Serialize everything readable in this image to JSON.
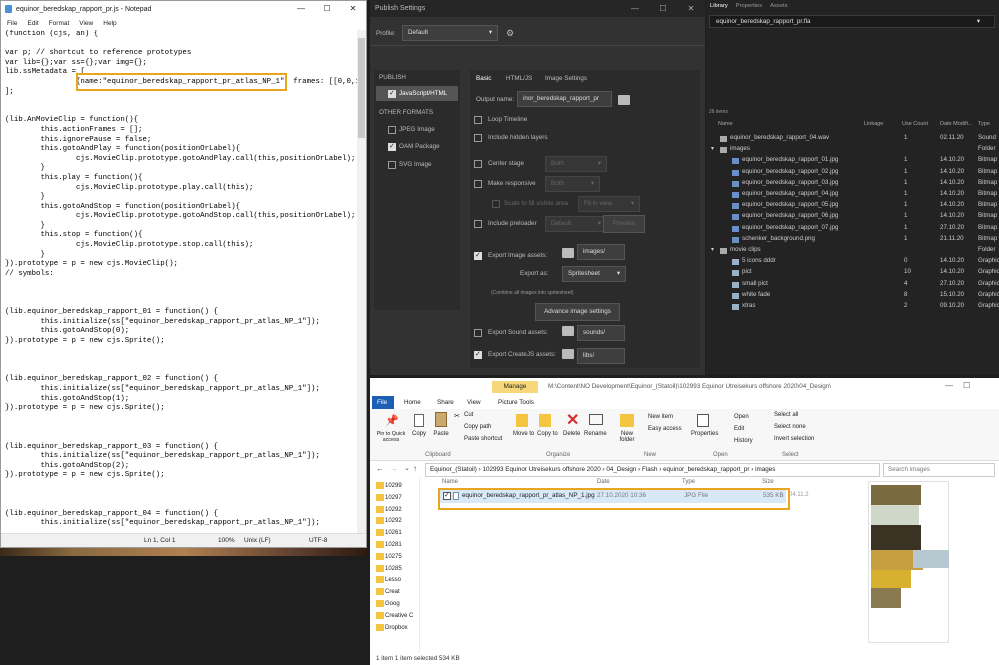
{
  "notepad": {
    "title": "equinor_beredskap_rapport_pr.js - Notepad",
    "menu": [
      "File",
      "Edit",
      "Format",
      "View",
      "Help"
    ],
    "code": "(function (cjs, an) {\n\nvar p; // shortcut to reference prototypes\nvar lib={};var ss={};var img={};\nlib.ssMetadata = [\n\t\t{name:\"equinor_beredskap_rapport_pr_atlas_NP_1\", frames: [[0,0,1344\n];\n\n\n(lib.AnMovieClip = function(){\n\tthis.actionFrames = [];\n\tthis.ignorePause = false;\n\tthis.gotoAndPlay = function(positionOrLabel){\n\t\tcjs.MovieClip.prototype.gotoAndPlay.call(this,positionOrLabel);\n\t}\n\tthis.play = function(){\n\t\tcjs.MovieClip.prototype.play.call(this);\n\t}\n\tthis.gotoAndStop = function(positionOrLabel){\n\t\tcjs.MovieClip.prototype.gotoAndStop.call(this,positionOrLabel);\n\t}\n\tthis.stop = function(){\n\t\tcjs.MovieClip.prototype.stop.call(this);\n\t}\n}).prototype = p = new cjs.MovieClip();\n// symbols:\n\n\n\n(lib.equinor_beredskap_rapport_01 = function() {\n\tthis.initialize(ss[\"equinor_beredskap_rapport_pr_atlas_NP_1\"]);\n\tthis.gotoAndStop(0);\n}).prototype = p = new cjs.Sprite();\n\n\n\n(lib.equinor_beredskap_rapport_02 = function() {\n\tthis.initialize(ss[\"equinor_beredskap_rapport_pr_atlas_NP_1\"]);\n\tthis.gotoAndStop(1);\n}).prototype = p = new cjs.Sprite();\n\n\n\n(lib.equinor_beredskap_rapport_03 = function() {\n\tthis.initialize(ss[\"equinor_beredskap_rapport_pr_atlas_NP_1\"]);\n\tthis.gotoAndStop(2);\n}).prototype = p = new cjs.Sprite();\n\n\n\n(lib.equinor_beredskap_rapport_04 = function() {\n\tthis.initialize(ss[\"equinor_beredskap_rapport_pr_atlas_NP_1\"]);",
    "status": {
      "position": "Ln 1, Col 1",
      "zoom": "100%",
      "eol": "Unix (LF)",
      "encoding": "UTF-8"
    }
  },
  "publish": {
    "title": "Publish Settings",
    "profile_label": "Profile:",
    "profile_value": "Default",
    "publish_header": "PUBLISH",
    "javascript": "JavaScript/HTML",
    "other_formats": "OTHER FORMATS",
    "formats": [
      "JPEG Image",
      "OAM Package",
      "SVG Image"
    ],
    "tabs": [
      "Basic",
      "HTML/JS",
      "Image Settings"
    ],
    "output_label": "Output name:",
    "output_value": "inor_beredskap_rapport_pr",
    "loop": "Loop Timeline",
    "hidden": "Include hidden layers",
    "center": "Center stage",
    "center_val": "Both",
    "responsive": "Make responsive",
    "responsive_val": "Both",
    "scale": "Scale to fill visible area",
    "scale_val": "Fit in view",
    "preloader": "Include preloader",
    "preloader_val": "Default",
    "preview": "Preview",
    "export_images": "Export Image assets:",
    "images_folder": "images/",
    "export_as_label": "Export as:",
    "export_as_val": "Spritesheet",
    "combine_note": "(Combine all images into spritesheet)",
    "advanced": "Advance image settings",
    "export_sound": "Export Sound assets:",
    "sounds_folder": "sounds/",
    "export_createjs": "Export CreateJS assets:",
    "libs_folder": "libs/"
  },
  "library": {
    "tabs": [
      "Library",
      "Properties",
      "Assets"
    ],
    "file": "equinor_beredskap_rapport_pr.fla",
    "count": "26 items",
    "headers": [
      "Name",
      "Linkage",
      "Use Count",
      "Date Modifi...",
      "Type"
    ],
    "rows": [
      {
        "indent": 0,
        "name": "equinor_beredskap_rapport_04.wav",
        "use": "1",
        "date": "02.11.20",
        "type": "Sound",
        "kind": "sound"
      },
      {
        "indent": 0,
        "name": "images",
        "use": "",
        "date": "",
        "type": "Folder",
        "kind": "folder"
      },
      {
        "indent": 1,
        "name": "equinor_beredskap_rapport_01.jpg",
        "use": "1",
        "date": "14.10.20",
        "type": "Bitmap",
        "kind": "bitmap"
      },
      {
        "indent": 1,
        "name": "equinor_beredskap_rapport_02.jpg",
        "use": "1",
        "date": "14.10.20",
        "type": "Bitmap",
        "kind": "bitmap"
      },
      {
        "indent": 1,
        "name": "equinor_beredskap_rapport_03.jpg",
        "use": "1",
        "date": "14.10.20",
        "type": "Bitmap",
        "kind": "bitmap"
      },
      {
        "indent": 1,
        "name": "equinor_beredskap_rapport_04.jpg",
        "use": "1",
        "date": "14.10.20",
        "type": "Bitmap",
        "kind": "bitmap"
      },
      {
        "indent": 1,
        "name": "equinor_beredskap_rapport_05.jpg",
        "use": "1",
        "date": "14.10.20",
        "type": "Bitmap",
        "kind": "bitmap"
      },
      {
        "indent": 1,
        "name": "equinor_beredskap_rapport_06.jpg",
        "use": "1",
        "date": "14.10.20",
        "type": "Bitmap",
        "kind": "bitmap"
      },
      {
        "indent": 1,
        "name": "equinor_beredskap_rapport_07.jpg",
        "use": "1",
        "date": "27.10.20",
        "type": "Bitmap",
        "kind": "bitmap"
      },
      {
        "indent": 1,
        "name": "schenker_background.png",
        "use": "1",
        "date": "21.11.20",
        "type": "Bitmap",
        "kind": "bitmap"
      },
      {
        "indent": 0,
        "name": "movie clips",
        "use": "",
        "date": "",
        "type": "Folder",
        "kind": "folder"
      },
      {
        "indent": 1,
        "name": "5 icons dddr",
        "use": "0",
        "date": "14.10.20",
        "type": "Graphic",
        "kind": "graphic"
      },
      {
        "indent": 1,
        "name": "pict",
        "use": "10",
        "date": "14.10.20",
        "type": "Graphic",
        "kind": "graphic"
      },
      {
        "indent": 1,
        "name": "small pict",
        "use": "4",
        "date": "27.10.20",
        "type": "Graphic",
        "kind": "graphic"
      },
      {
        "indent": 1,
        "name": "white fade",
        "use": "8",
        "date": "15.10.20",
        "type": "Graphic",
        "kind": "graphic"
      },
      {
        "indent": 1,
        "name": "xtras",
        "use": "2",
        "date": "09.10.20",
        "type": "Graphic",
        "kind": "graphic"
      }
    ]
  },
  "explorer": {
    "title": "M:\\Content\\NO Development\\Equinor_(Statoil)\\102993 Equinor Utreisekurs offshore 2020\\04_Design\\",
    "manage": "Manage",
    "tabs": [
      "File",
      "Home",
      "Share",
      "View",
      "Picture Tools"
    ],
    "ribbon": {
      "pin": "Pin to Quick access",
      "copy": "Copy",
      "paste": "Paste",
      "cut": "Cut",
      "copy_path": "Copy path",
      "paste_shortcut": "Paste shortcut",
      "move": "Move to",
      "copy_to": "Copy to",
      "delete": "Delete",
      "rename": "Rename",
      "new_folder": "New folder",
      "new_item": "New item",
      "easy_access": "Easy access",
      "properties": "Properties",
      "open": "Open",
      "edit": "Edit",
      "history": "History",
      "select_all": "Select all",
      "select_none": "Select none",
      "invert": "Invert selection",
      "groups": [
        "Clipboard",
        "Organize",
        "New",
        "Open",
        "Select"
      ]
    },
    "breadcrumb": [
      "Equinor_(Statoil)",
      "102993 Equinor Utreisekurs offshore 2020",
      "04_Design",
      "Flash",
      "equinor_beredskap_rapport_pr",
      "images"
    ],
    "search_placeholder": "Search images",
    "nav": [
      "10299",
      "10297",
      "10292",
      "10292",
      "10261",
      "10281",
      "10275",
      "10285",
      "Lesso",
      "Creat",
      "Goog",
      "Creative C",
      "Dropbox"
    ],
    "columns": [
      "Name",
      "Date",
      "Type",
      "Size"
    ],
    "file": {
      "name": "equinor_beredskap_rapport_pr_atlas_NP_1.jpg",
      "date": "27.10.2020 10:36",
      "type": "JPG File",
      "size": "535 KB",
      "extra": "04.11.2"
    },
    "status": "1 item    1 item selected  534 KB"
  }
}
